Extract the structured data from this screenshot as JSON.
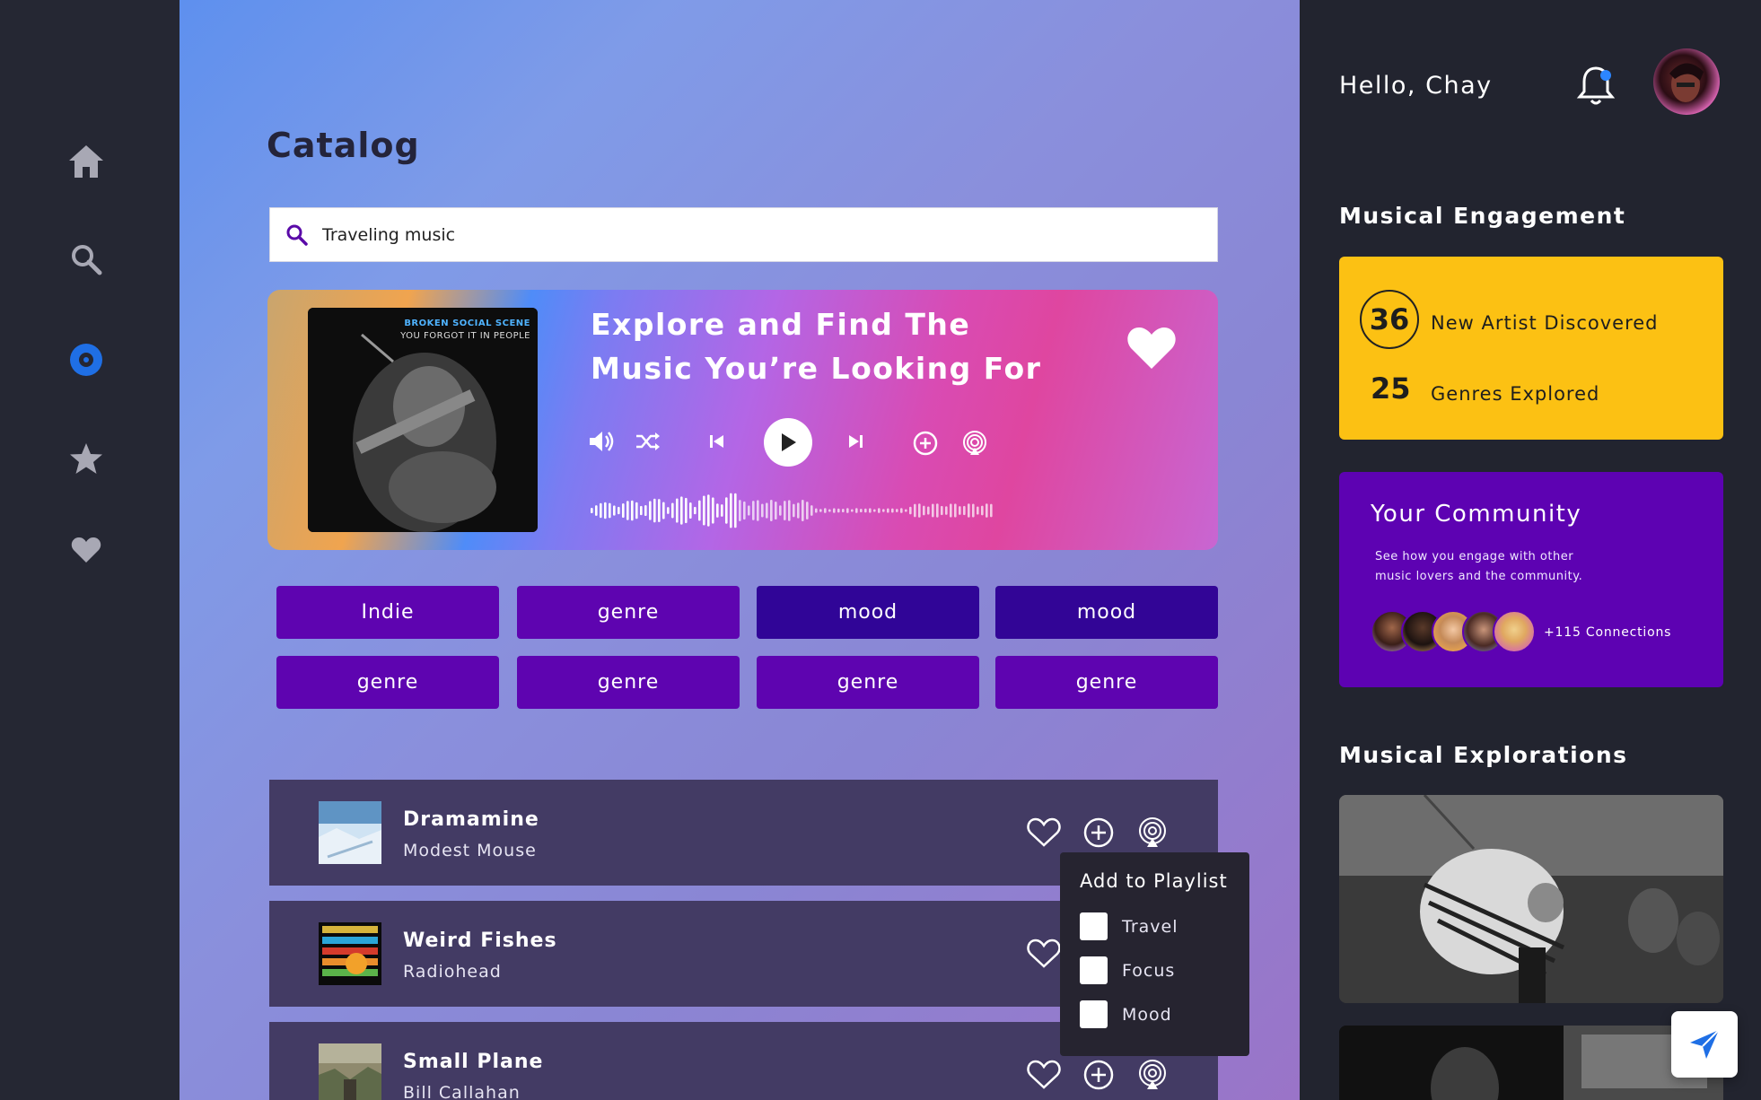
{
  "sidebar": {
    "items": [
      {
        "icon": "home-icon"
      },
      {
        "icon": "search-icon"
      },
      {
        "icon": "disc-icon",
        "active": true
      },
      {
        "icon": "star-icon"
      },
      {
        "icon": "heart-icon"
      }
    ]
  },
  "main": {
    "title": "Catalog",
    "search": {
      "value": "Traveling music"
    },
    "hero": {
      "album_caption_line1": "BROKEN SOCIAL SCENE",
      "album_caption_line2": "YOU FORGOT IT IN PEOPLE",
      "title": "Explore and Find The Music You’re Looking For",
      "liked": true
    },
    "chips": [
      "Indie",
      "genre",
      "mood",
      "mood",
      "genre",
      "genre",
      "genre",
      "genre"
    ],
    "tracks": [
      {
        "title": "Dramamine",
        "artist": "Modest Mouse"
      },
      {
        "title": "Weird Fishes",
        "artist": "Radiohead"
      },
      {
        "title": "Small Plane",
        "artist": "Bill Callahan"
      }
    ],
    "playlist_popup": {
      "title": "Add to Playlist",
      "options": [
        "Travel",
        "Focus",
        "Mood"
      ]
    }
  },
  "right": {
    "greeting": "Hello, Chay",
    "engagement": {
      "title": "Musical Engagement",
      "artists_count": "36",
      "artists_label": "New Artist Discovered",
      "genres_count": "25",
      "genres_label": "Genres Explored"
    },
    "community": {
      "title": "Your Community",
      "description": "See how you engage with other music lovers and the community.",
      "connections": "+115 Connections"
    },
    "explorations": {
      "title": "Musical Explorations"
    }
  },
  "colors": {
    "accent_blue": "#1f6fe5",
    "chip_purple": "#5e04b0",
    "chip_dark": "#300597",
    "engagement_yellow": "#fcc113",
    "community_purple": "#5d02b2"
  }
}
